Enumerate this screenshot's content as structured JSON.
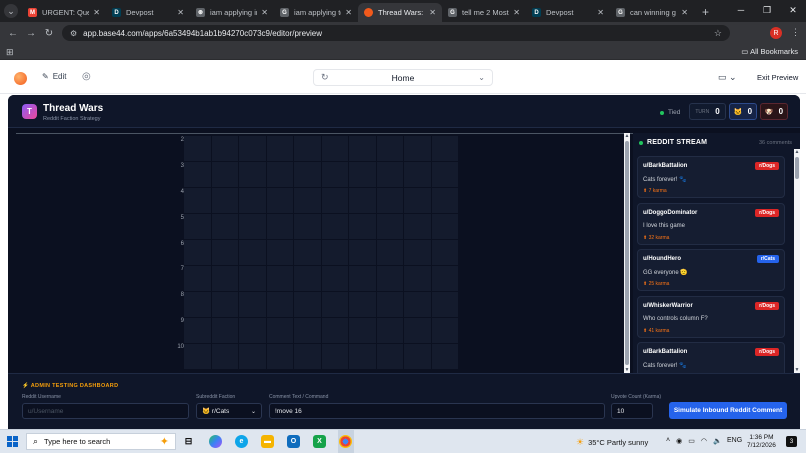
{
  "browser": {
    "tabs": [
      {
        "title": "URGENT: Query",
        "icon": "gmail-icon",
        "fav_text": "M",
        "fav_color": "#ea4335"
      },
      {
        "title": "Devpost",
        "icon": "devpost-icon",
        "fav_text": "D",
        "fav_color": "#003e54"
      },
      {
        "title": "iam applying in",
        "icon": "chatgpt-icon",
        "fav_text": "⊛",
        "fav_color": "#5f6368"
      },
      {
        "title": "iam applying to",
        "icon": "google-icon",
        "fav_text": "G",
        "fav_color": "#5f6368"
      },
      {
        "title": "Thread Wars: Re",
        "icon": "base44-icon",
        "fav_text": "",
        "fav_color": "#f25a1c",
        "active": true
      },
      {
        "title": "tell me 2 Most p",
        "icon": "google-icon",
        "fav_text": "G",
        "fav_color": "#5f6368"
      },
      {
        "title": "Devpost",
        "icon": "devpost-icon",
        "fav_text": "D",
        "fav_color": "#003e54"
      },
      {
        "title": "can winning g Pr",
        "icon": "google-icon",
        "fav_text": "G",
        "fav_color": "#5f6368"
      }
    ],
    "url": "app.base44.com/apps/6a53494b1ab1b94270c073c9/editor/preview",
    "profile_initial": "R",
    "all_bookmarks": "All Bookmarks"
  },
  "editor": {
    "edit_label": "Edit",
    "page_name": "Home",
    "exit_preview": "Exit Preview"
  },
  "app": {
    "logo_letter": "T",
    "title": "Thread Wars",
    "subtitle": "Reddit Faction Strategy",
    "status": "Tied",
    "turn_label": "TURN",
    "turn_value": "0",
    "cats_score": "0",
    "dogs_score": "0"
  },
  "grid": {
    "row_labels": [
      "2",
      "3",
      "4",
      "5",
      "6",
      "7",
      "8",
      "9",
      "10"
    ],
    "columns": 10
  },
  "stream": {
    "title": "REDDIT STREAM",
    "count": "36 comments",
    "comments": [
      {
        "user": "u/BarkBattalion",
        "text": "Cats forever! 🐾",
        "karma": "⬆ 7 karma",
        "faction": "r/Dogs",
        "faction_class": "dogs"
      },
      {
        "user": "u/DoggoDominator",
        "text": "I love this game",
        "karma": "⬆ 32 karma",
        "faction": "r/Dogs",
        "faction_class": "dogs"
      },
      {
        "user": "u/HoundHero",
        "text": "GG everyone 🫡",
        "karma": "⬆ 25 karma",
        "faction": "r/Cats",
        "faction_class": "cats"
      },
      {
        "user": "u/WhiskerWarrior",
        "text": "Who controls column F?",
        "karma": "⬆ 41 karma",
        "faction": "r/Dogs",
        "faction_class": "dogs"
      },
      {
        "user": "u/BarkBattalion",
        "text": "Cats forever! 🐾",
        "karma": "⬆ 3 karma",
        "faction": "r/Dogs",
        "faction_class": "dogs"
      }
    ]
  },
  "admin": {
    "title": "⚡ ADMIN TESTING DASHBOARD",
    "username_label": "Reddit Username",
    "username_placeholder": "u/Username",
    "username_value": "",
    "faction_label": "Subreddit Faction",
    "faction_value": "🐱 r/Cats",
    "comment_label": "Comment Text / Command",
    "comment_value": "!move 16",
    "upvote_label": "Upvote Count (Karma)",
    "upvote_value": "10",
    "submit_label": "Simulate Inbound Reddit Comment"
  },
  "taskbar": {
    "search_placeholder": "Type here to search",
    "weather": "35°C  Partly sunny",
    "lang": "ENG",
    "time": "1:36 PM",
    "date": "7/12/2026",
    "notif_count": "3"
  }
}
